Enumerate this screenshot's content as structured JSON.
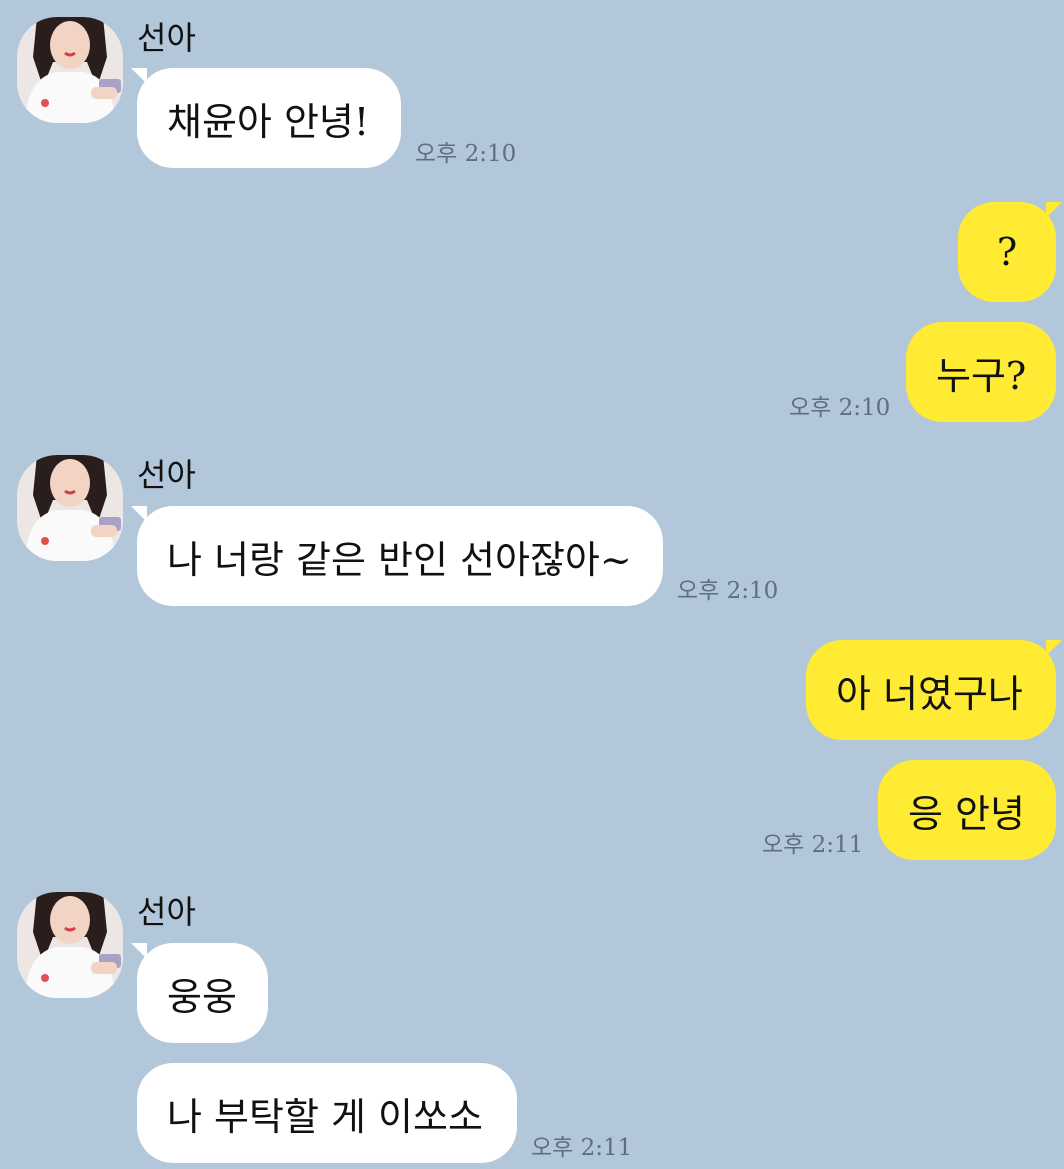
{
  "contact": {
    "name": "선아"
  },
  "messages": [
    {
      "sender": "선아",
      "text": "채윤아 안녕!",
      "time": "오후 2:10"
    },
    {
      "sender": "me",
      "text": "?"
    },
    {
      "sender": "me",
      "text": "누구?",
      "time": "오후 2:10"
    },
    {
      "sender": "선아",
      "text": "나 너랑 같은 반인 선아잖아~",
      "time": "오후 2:10"
    },
    {
      "sender": "me",
      "text": "아 너였구나"
    },
    {
      "sender": "me",
      "text": "응 안녕",
      "time": "오후 2:11"
    },
    {
      "sender": "선아",
      "text": "웅웅"
    },
    {
      "sender": "선아",
      "text": "나 부탁할 게 이쏘소",
      "time": "오후 2:11"
    }
  ],
  "colors": {
    "background": "#b2c7da",
    "incoming_bubble": "#ffffff",
    "outgoing_bubble": "#ffeb33",
    "timestamp": "#5f6f7e"
  },
  "icons": {
    "avatar": "profile-photo"
  }
}
